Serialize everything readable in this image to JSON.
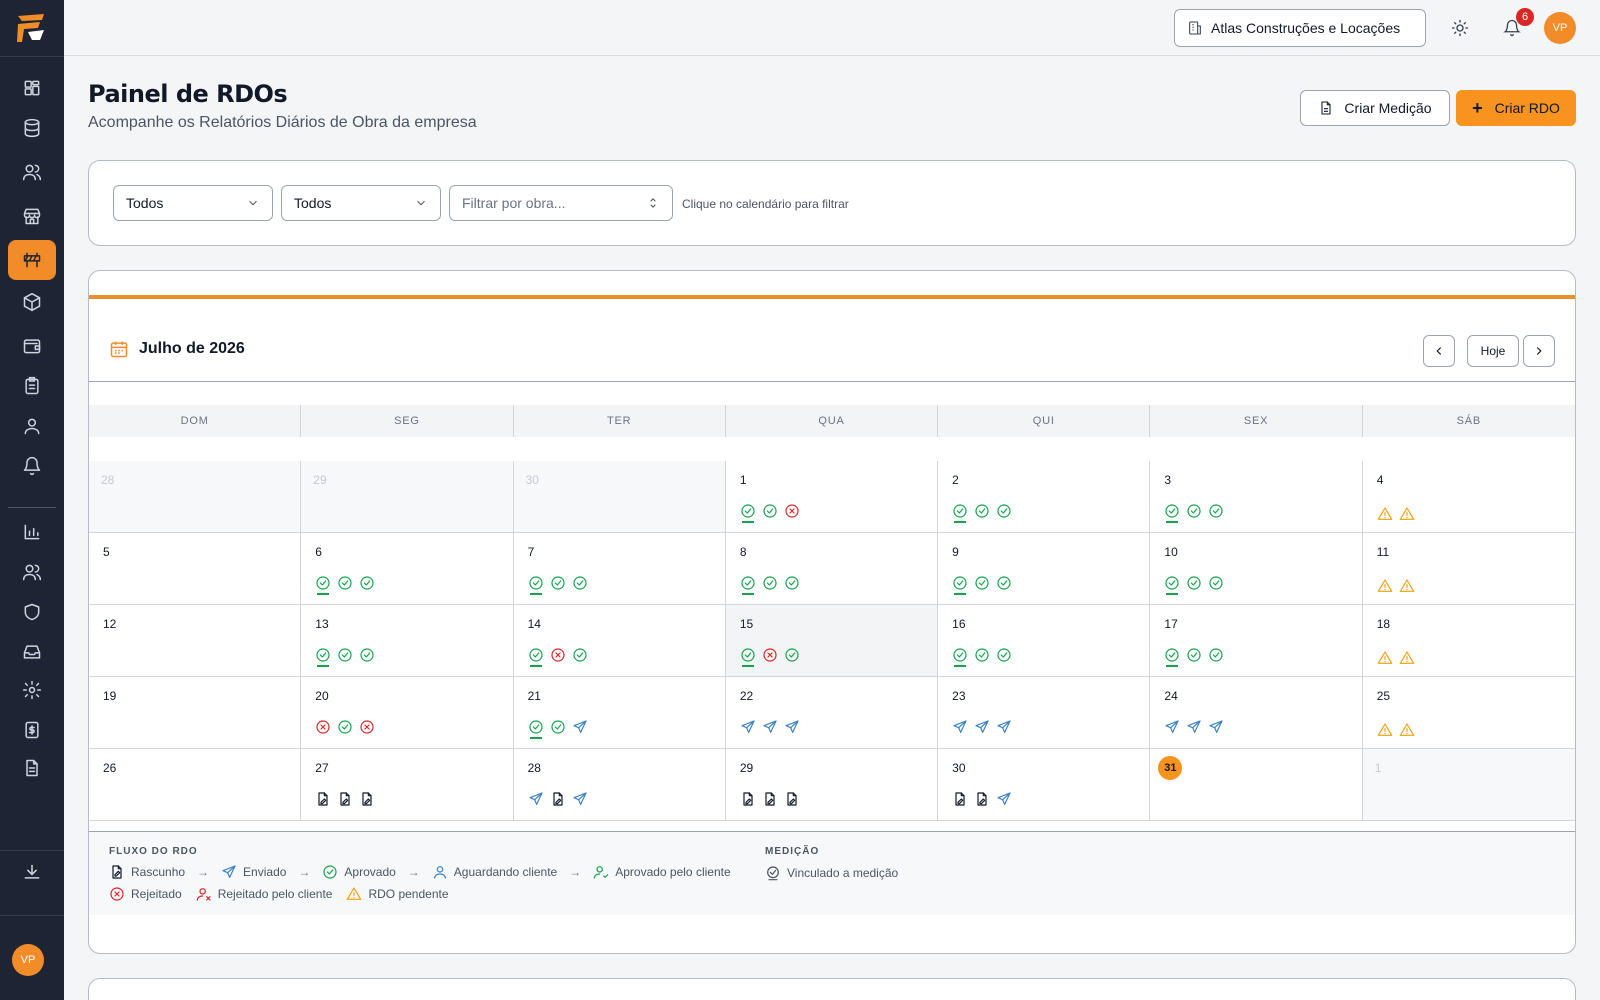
{
  "app": {
    "logo": "logo-icon"
  },
  "sidebar": {
    "items": [
      {
        "name": "dashboard-icon"
      },
      {
        "name": "database-icon"
      },
      {
        "name": "users-icon"
      },
      {
        "name": "store-icon"
      },
      {
        "name": "construction-icon",
        "active": true
      },
      {
        "name": "box-icon"
      },
      {
        "name": "wallet-icon"
      },
      {
        "name": "clipboard-icon"
      },
      {
        "name": "user-icon"
      },
      {
        "name": "bell-icon"
      },
      {
        "name": "chart-icon"
      },
      {
        "name": "team-icon"
      },
      {
        "name": "shield-icon"
      },
      {
        "name": "inbox-icon"
      },
      {
        "name": "gear-icon"
      },
      {
        "name": "receipt-icon"
      },
      {
        "name": "document-icon"
      },
      {
        "name": "download-icon"
      }
    ],
    "avatar": "VP"
  },
  "topbar": {
    "company": "Atlas Construções e Locações",
    "notifications": "6",
    "avatar": "VP"
  },
  "header": {
    "title": "Painel de RDOs",
    "subtitle": "Acompanhe os Relatórios Diários de Obra da empresa",
    "create_measure": "Criar Medição",
    "create_rdo": "Criar RDO"
  },
  "filters": {
    "select1": "Todos",
    "select2": "Todos",
    "obra_placeholder": "Filtrar por obra...",
    "hint": "Clique no calendário para filtrar"
  },
  "calendar": {
    "title": "Julho de 2026",
    "today_label": "Hoje",
    "weekdays": [
      "DOM",
      "SEG",
      "TER",
      "QUA",
      "QUI",
      "SEX",
      "SÁB"
    ],
    "today": "31",
    "days": [
      {
        "n": "28",
        "outside": true,
        "icons": []
      },
      {
        "n": "29",
        "outside": true,
        "icons": []
      },
      {
        "n": "30",
        "outside": true,
        "icons": []
      },
      {
        "n": "1",
        "icons": [
          "approved-linked",
          "approved",
          "rejected"
        ]
      },
      {
        "n": "2",
        "icons": [
          "approved-linked",
          "approved",
          "approved"
        ]
      },
      {
        "n": "3",
        "icons": [
          "approved-linked",
          "approved",
          "approved"
        ]
      },
      {
        "n": "4",
        "icons": [
          "pending",
          "pending"
        ]
      },
      {
        "n": "5",
        "icons": []
      },
      {
        "n": "6",
        "icons": [
          "approved-linked",
          "approved",
          "approved"
        ]
      },
      {
        "n": "7",
        "icons": [
          "approved-linked",
          "approved",
          "approved"
        ]
      },
      {
        "n": "8",
        "icons": [
          "approved-linked",
          "approved",
          "approved"
        ]
      },
      {
        "n": "9",
        "icons": [
          "approved-linked",
          "approved",
          "approved"
        ]
      },
      {
        "n": "10",
        "icons": [
          "approved-linked",
          "approved",
          "approved"
        ]
      },
      {
        "n": "11",
        "icons": [
          "pending",
          "pending"
        ]
      },
      {
        "n": "12",
        "icons": []
      },
      {
        "n": "13",
        "icons": [
          "approved-linked",
          "approved",
          "approved"
        ]
      },
      {
        "n": "14",
        "icons": [
          "approved-linked",
          "rejected",
          "approved"
        ]
      },
      {
        "n": "15",
        "highlight": true,
        "icons": [
          "approved-linked",
          "rejected",
          "approved"
        ]
      },
      {
        "n": "16",
        "icons": [
          "approved-linked",
          "approved",
          "approved"
        ]
      },
      {
        "n": "17",
        "icons": [
          "approved-linked",
          "approved",
          "approved"
        ]
      },
      {
        "n": "18",
        "icons": [
          "pending",
          "pending"
        ]
      },
      {
        "n": "19",
        "icons": []
      },
      {
        "n": "20",
        "icons": [
          "rejected",
          "approved",
          "rejected"
        ]
      },
      {
        "n": "21",
        "icons": [
          "approved-linked",
          "approved",
          "sent"
        ]
      },
      {
        "n": "22",
        "icons": [
          "sent",
          "sent",
          "sent"
        ]
      },
      {
        "n": "23",
        "icons": [
          "sent",
          "sent",
          "sent"
        ]
      },
      {
        "n": "24",
        "icons": [
          "sent",
          "sent",
          "sent"
        ]
      },
      {
        "n": "25",
        "icons": [
          "pending",
          "pending"
        ]
      },
      {
        "n": "26",
        "icons": []
      },
      {
        "n": "27",
        "icons": [
          "draft",
          "draft",
          "draft"
        ]
      },
      {
        "n": "28",
        "icons": [
          "sent",
          "draft",
          "sent"
        ]
      },
      {
        "n": "29",
        "icons": [
          "draft",
          "draft",
          "draft"
        ]
      },
      {
        "n": "30",
        "icons": [
          "draft",
          "draft",
          "sent"
        ]
      },
      {
        "n": "31",
        "today": true,
        "icons": []
      },
      {
        "n": "1",
        "outside": true,
        "icons": []
      }
    ]
  },
  "legend": {
    "flow_title": "FLUXO DO RDO",
    "draft": "Rascunho",
    "sent": "Enviado",
    "approved": "Aprovado",
    "awaiting_client": "Aguardando cliente",
    "approved_client": "Aprovado pelo cliente",
    "rejected": "Rejeitado",
    "rejected_client": "Rejeitado pelo cliente",
    "pending": "RDO pendente",
    "measure_title": "MEDIÇÃO",
    "linked": "Vinculado a medição"
  }
}
